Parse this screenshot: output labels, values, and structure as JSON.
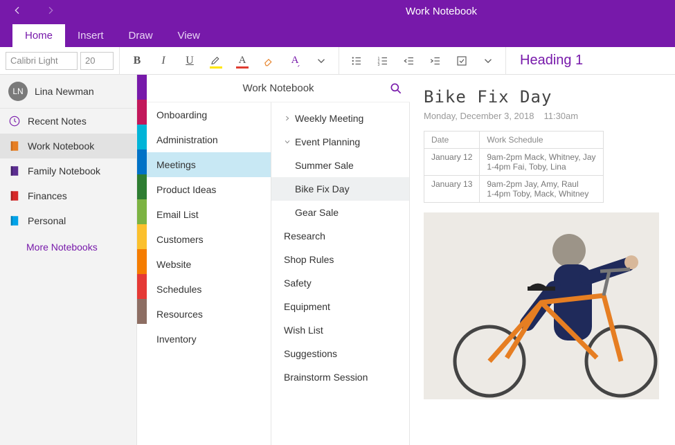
{
  "app_title": "Work Notebook",
  "tabs": {
    "home": "Home",
    "insert": "Insert",
    "draw": "Draw",
    "view": "View"
  },
  "ribbon": {
    "font_name": "Calibri Light",
    "font_size": "20",
    "heading": "Heading 1",
    "highlight_color": "#ffe600",
    "font_color": "#e03c31"
  },
  "user": {
    "initials": "LN",
    "name": "Lina Newman"
  },
  "sidebar": {
    "recent": "Recent Notes",
    "items": [
      {
        "label": "Work Notebook",
        "color": "#e67e22"
      },
      {
        "label": "Family Notebook",
        "color": "#5b2d90"
      },
      {
        "label": "Finances",
        "color": "#d62828"
      },
      {
        "label": "Personal",
        "color": "#00a2e8"
      }
    ],
    "more": "More Notebooks"
  },
  "section_header": "Work Notebook",
  "section_colors": [
    "#7719aa",
    "#c2185b",
    "#00b4d8",
    "#0072c6",
    "#2e7d32",
    "#7cb342",
    "#fbc02d",
    "#f57c00",
    "#e53935",
    "#8d6e63"
  ],
  "sections": [
    "Onboarding",
    "Administration",
    "Meetings",
    "Product Ideas",
    "Email List",
    "Customers",
    "Website",
    "Schedules",
    "Resources",
    "Inventory"
  ],
  "active_section_index": 2,
  "pages": [
    {
      "label": "Weekly Meeting",
      "collapsed": true
    },
    {
      "label": "Event Planning",
      "expanded": true
    },
    {
      "label": "Summer Sale",
      "sub": true
    },
    {
      "label": "Bike Fix Day",
      "sub": true,
      "active": true
    },
    {
      "label": "Gear Sale",
      "sub": true
    },
    {
      "label": "Research"
    },
    {
      "label": "Shop Rules"
    },
    {
      "label": "Safety"
    },
    {
      "label": "Equipment"
    },
    {
      "label": "Wish List"
    },
    {
      "label": "Suggestions"
    },
    {
      "label": "Brainstorm Session"
    }
  ],
  "note": {
    "title": "Bike Fix Day",
    "date": "Monday, December 3, 2018",
    "time": "11:30am",
    "table": {
      "headers": [
        "Date",
        "Work Schedule"
      ],
      "rows": [
        [
          "January 12",
          "9am-2pm Mack, Whitney, Jay\n1-4pm Fai, Toby, Lina"
        ],
        [
          "January 13",
          "9am-2pm Jay, Amy, Raul\n1-4pm Toby, Mack, Whitney"
        ]
      ]
    }
  }
}
